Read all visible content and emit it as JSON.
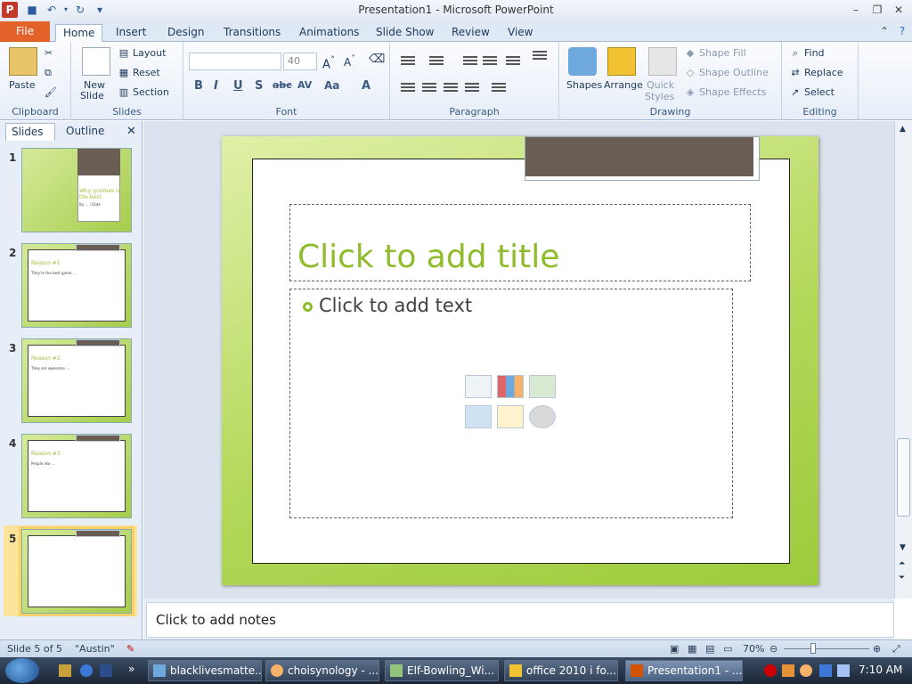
{
  "window": {
    "title": "Presentation1 - Microsoft PowerPoint"
  },
  "ribbon_tabs": [
    "File",
    "Home",
    "Insert",
    "Design",
    "Transitions",
    "Animations",
    "Slide Show",
    "Review",
    "View"
  ],
  "clipboard": {
    "paste": "Paste",
    "label": "Clipboard"
  },
  "slides_group": {
    "new_slide": "New",
    "new_slide2": "Slide",
    "layout": "Layout",
    "reset": "Reset",
    "section": "Section",
    "label": "Slides"
  },
  "font_group": {
    "size": "40",
    "label": "Font"
  },
  "paragraph_group": {
    "label": "Paragraph"
  },
  "drawing_group": {
    "shapes": "Shapes",
    "arrange": "Arrange",
    "quick_styles": "Quick",
    "quick_styles2": "Styles",
    "shape_fill": "Shape Fill",
    "shape_outline": "Shape Outline",
    "shape_effects": "Shape Effects",
    "label": "Drawing"
  },
  "editing_group": {
    "find": "Find",
    "replace": "Replace",
    "select": "Select",
    "label": "Editing"
  },
  "left_pane": {
    "tab_slides": "Slides",
    "tab_outline": "Outline"
  },
  "thumbnails": [
    {
      "num": "1",
      "title": "Why gnomes is the best",
      "body": "By … / Date"
    },
    {
      "num": "2",
      "title": "Reason #1",
      "body": "They're the best game …"
    },
    {
      "num": "3",
      "title": "Reason #2",
      "body": "They are awesome …"
    },
    {
      "num": "4",
      "title": "Reason #3",
      "body": "People like …"
    },
    {
      "num": "5",
      "title": "",
      "body": ""
    }
  ],
  "slide": {
    "title_placeholder": "Click to add title",
    "text_placeholder": "Click to add text"
  },
  "notes": {
    "placeholder": "Click to add notes"
  },
  "status": {
    "slide_info": "Slide 5 of 5",
    "theme": "\"Austin\"",
    "zoom": "70%"
  },
  "taskbar": {
    "items": [
      "blacklivesmatte...",
      "choisynology - ...",
      "Elf-Bowling_Wi...",
      "office 2010 i fo...",
      "Presentation1 - ..."
    ],
    "clock": "7:10 AM"
  },
  "colors": {
    "accent_green": "#8fbc2b",
    "file_tab": "#e3622a",
    "header_bar": "#6a5e54"
  }
}
